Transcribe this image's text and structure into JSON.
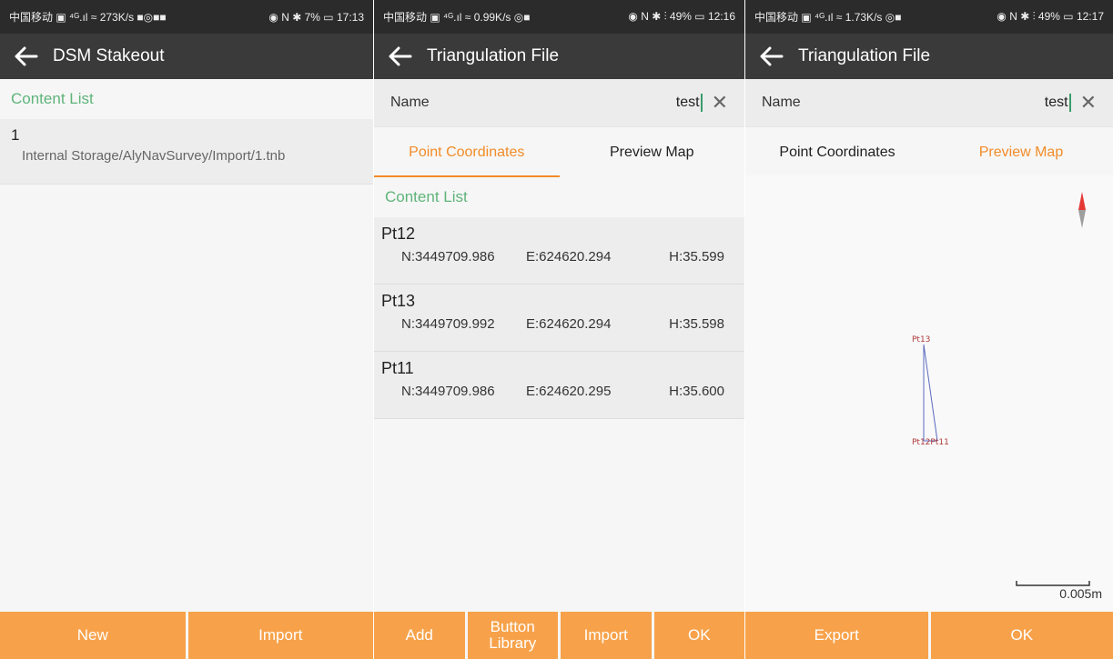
{
  "panels": [
    {
      "status": {
        "left": "中国移动 ▣ ⁴ᴳ.ıl ≈ 273K/s ■◎■■",
        "right": "◉ N ✱ 7% ▭ 17:13"
      },
      "title": "DSM Stakeout",
      "content_label": "Content List",
      "files": [
        {
          "name": "1",
          "path": "Internal Storage/AlyNavSurvey/Import/1.tnb"
        }
      ],
      "buttons": {
        "new": "New",
        "import": "Import"
      }
    },
    {
      "status": {
        "left": "中国移动 ▣ ⁴ᴳ.ıl ≈ 0.99K/s ◎■",
        "right": "◉ N ✱ ⫶ 49% ▭ 12:16"
      },
      "title": "Triangulation File",
      "name_label": "Name",
      "name_value": "test",
      "tabs": {
        "coords": "Point Coordinates",
        "map": "Preview Map"
      },
      "content_label": "Content List",
      "points": [
        {
          "name": "Pt12",
          "n": "N:3449709.986",
          "e": "E:624620.294",
          "h": "H:35.599"
        },
        {
          "name": "Pt13",
          "n": "N:3449709.992",
          "e": "E:624620.294",
          "h": "H:35.598"
        },
        {
          "name": "Pt11",
          "n": "N:3449709.986",
          "e": "E:624620.295",
          "h": "H:35.600"
        }
      ],
      "buttons": {
        "add": "Add",
        "button_library_1": "Button",
        "button_library_2": "Library",
        "import": "Import",
        "ok": "OK"
      }
    },
    {
      "status": {
        "left": "中国移动 ▣ ⁴ᴳ.ıl ≈ 1.73K/s ◎■",
        "right": "◉ N ✱ ⫶ 49% ▭ 12:17"
      },
      "title": "Triangulation File",
      "name_label": "Name",
      "name_value": "test",
      "tabs": {
        "coords": "Point Coordinates",
        "map": "Preview Map"
      },
      "map": {
        "labels": {
          "pt13": "Pt13",
          "pt12pt11": "Pt12Pt11"
        },
        "scale": "0.005m"
      },
      "buttons": {
        "export": "Export",
        "ok": "OK"
      }
    }
  ]
}
